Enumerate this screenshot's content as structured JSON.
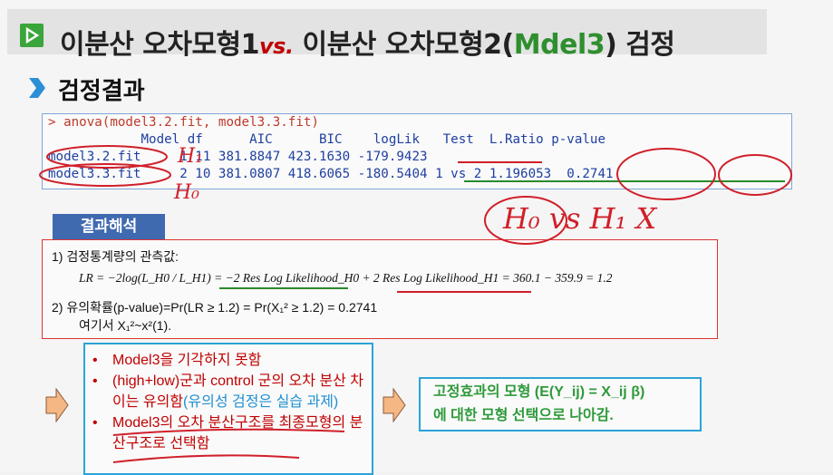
{
  "title": {
    "part1": "이분산 오차모형1",
    "vs": "vs.",
    "part2": "이분산 오차모형2(",
    "model": "Mdel3",
    "part3": ") 검정"
  },
  "section_heading": "검정결과",
  "console": {
    "command": "> anova(model3.2.fit, model3.3.fit)",
    "header": "            Model df      AIC      BIC    logLik   Test  L.Ratio p-value",
    "row1": "model3.2.fit     1 11 381.8847 423.1630 -179.9423",
    "row2": "model3.3.fit     2 10 381.0807 418.6065 -180.5404 1 vs 2 1.196053  0.2741"
  },
  "interpretation": {
    "tab_label": "결과해석",
    "item1_label": "1)   검정통계량의 관측값:",
    "item1_formula": "LR = −2log(L_H0 / L_H1) = −2 Res Log Likelihood_H0 + 2 Res Log Likelihood_H1 = 360.1 − 359.9 = 1.2",
    "item2_label": "2)   유의확률(p-value)=Pr(LR ≥ 1.2) = Pr(X₁² ≥ 1.2) = 0.2741",
    "item2_note": "여기서 X₁²~x²(1)."
  },
  "conclusion": {
    "bullet1": "Model3을 기각하지 못함",
    "bullet2_a": "(high+low)군과 control 군의 오차 분산 차이는 유의함",
    "bullet2_b": "(유의성 검정은 실습 과제)",
    "bullet3": "Model3의 오차 분산구조를 최종모형의 분산구조로 선택함"
  },
  "next_step": {
    "line1": "고정효과의 모형 (E(Y_ij) = X_ij β)",
    "line2": "에 대한 모형 선택으로 나아감."
  },
  "handwriting": {
    "h1": "H₁",
    "h0": "H₀",
    "note": "H₀ vs H₁ X"
  },
  "colors": {
    "accent_green": "#3aa53a",
    "red": "#c00000",
    "blue_border": "#2aa4d8",
    "tab_blue": "#3f6ab0",
    "console_text": "#1f3fa0"
  }
}
